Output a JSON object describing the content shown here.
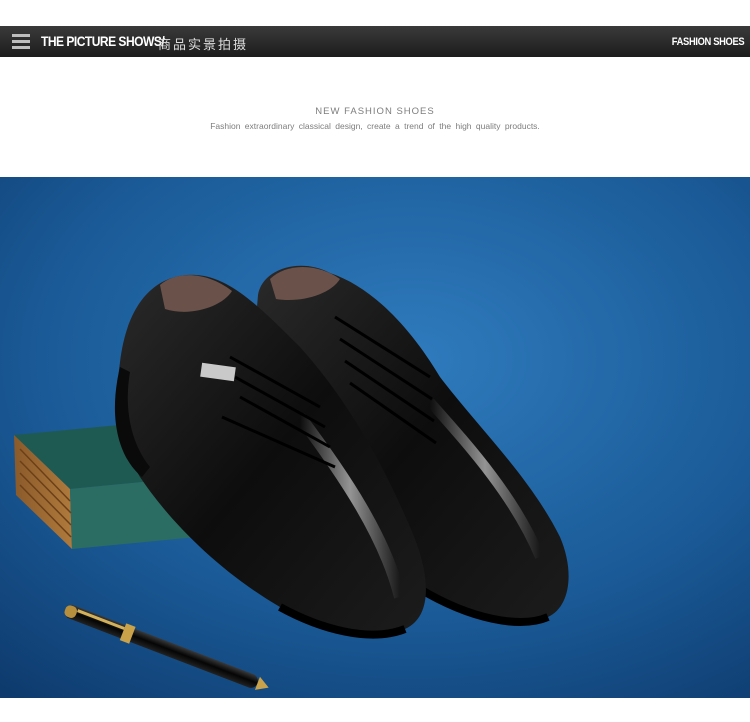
{
  "header": {
    "title": "THE PICTURE SHOWS/",
    "subtitle": "商品实景拍摄",
    "right_label": "FASHION SHOES"
  },
  "intro": {
    "heading": "NEW FASHION SHOES",
    "tagline": "Fashion extraordinary classical design, create a trend of the high quality products."
  },
  "photo": {
    "icon": "product-photo",
    "background_color": "#1e5c95",
    "brand_plate": "[brand]"
  }
}
